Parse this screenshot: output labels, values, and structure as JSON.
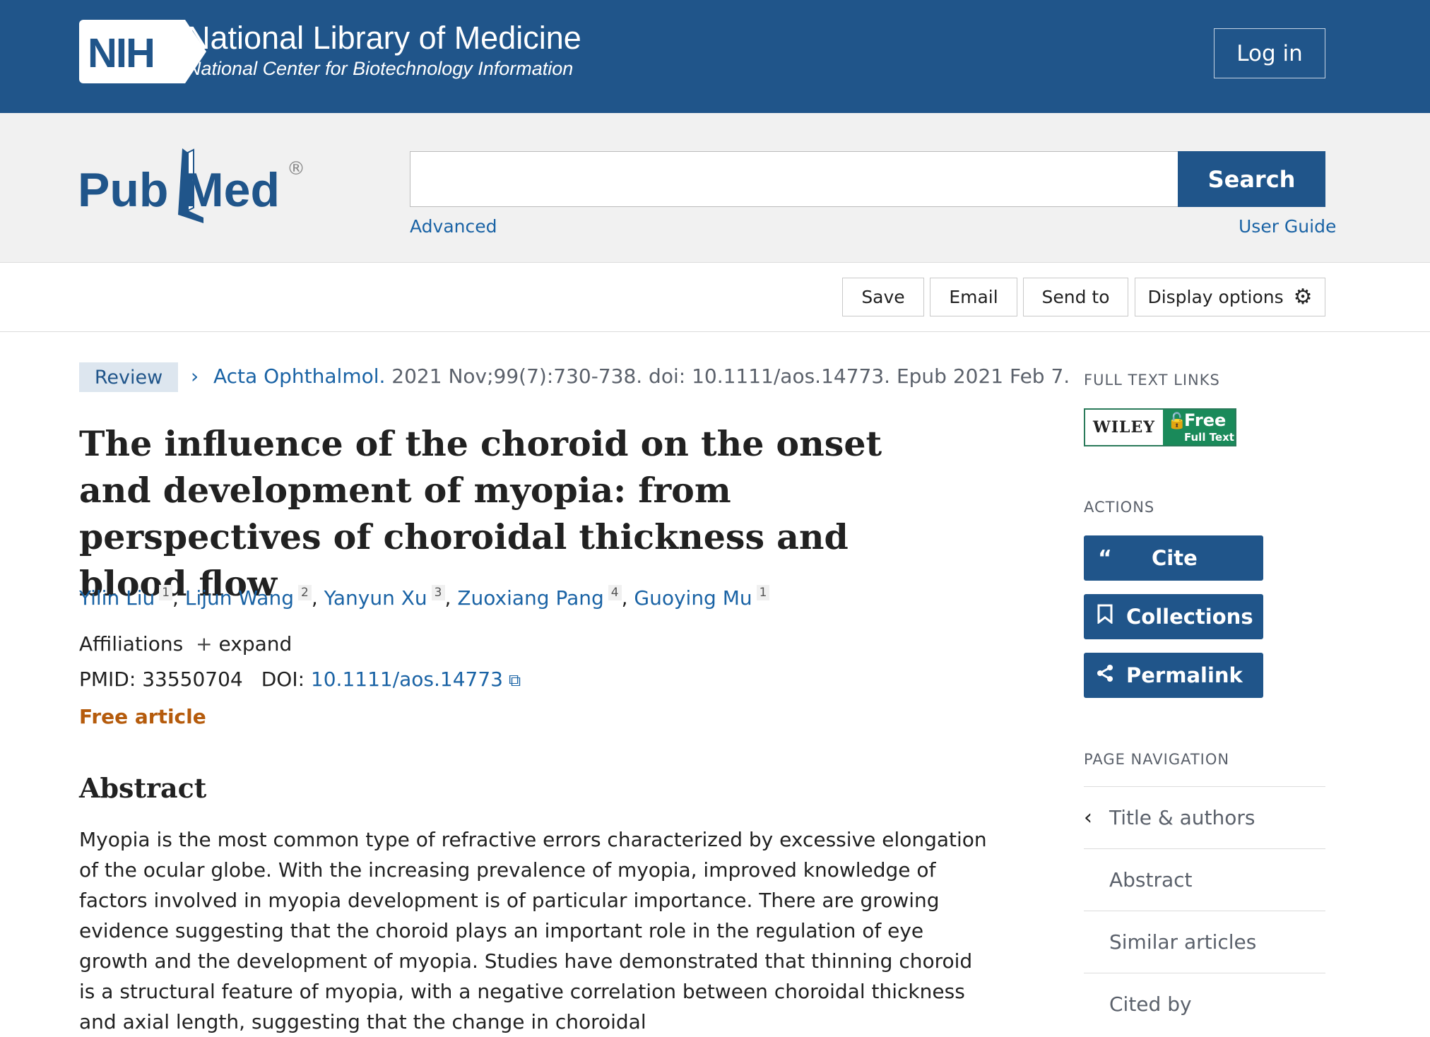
{
  "nih": {
    "badge": "NIH",
    "title": "National Library of Medicine",
    "subtitle": "National Center for Biotechnology Information",
    "login_label": "Log in"
  },
  "search": {
    "logo_pub": "Pub",
    "logo_med": "Med",
    "logo_reg": "®",
    "value": "",
    "placeholder": "",
    "button_label": "Search",
    "advanced_label": "Advanced",
    "guide_label": "User Guide"
  },
  "toolbar": {
    "save_label": "Save",
    "email_label": "Email",
    "send_label": "Send to",
    "display_label": "Display options"
  },
  "article": {
    "type": "Review",
    "journal": "Acta Ophthalmol.",
    "citation_rest": " 2021 Nov;99(7):730-738. doi: 10.1111/aos.14773. Epub 2021 Feb 7.",
    "title": "The influence of the choroid on the onset and development of myopia: from perspectives of choroidal thickness and blood flow",
    "authors": [
      {
        "name": "Yilin Liu",
        "aff": "1"
      },
      {
        "name": "Lijun Wang",
        "aff": "2"
      },
      {
        "name": "Yanyun Xu",
        "aff": "3"
      },
      {
        "name": "Zuoxiang Pang",
        "aff": "4"
      },
      {
        "name": "Guoying Mu",
        "aff": "1"
      }
    ],
    "affiliations_label": "Affiliations",
    "expand_label": "expand",
    "pmid_label": "PMID: 33550704",
    "doi_label": "DOI:",
    "doi_value": "10.1111/aos.14773",
    "free_label": "Free article",
    "abstract_heading": "Abstract",
    "abstract_text": "Myopia is the most common type of refractive errors characterized by excessive elongation of the ocular globe. With the increasing prevalence of myopia, improved knowledge of factors involved in myopia development is of particular importance. There are growing evidence suggesting that the choroid plays an important role in the regulation of eye growth and the development of myopia. Studies have demonstrated that thinning choroid is a structural feature of myopia, with a negative correlation between choroidal thickness and axial length, suggesting that the change in choroidal"
  },
  "sidebar": {
    "full_text_label": "FULL TEXT LINKS",
    "wiley_name": "WILEY",
    "wiley_free": "Free",
    "wiley_fulltext": "Full Text",
    "actions_label": "ACTIONS",
    "cite_label": "Cite",
    "collections_label": "Collections",
    "permalink_label": "Permalink",
    "page_nav_label": "PAGE NAVIGATION",
    "nav_items": [
      "Title & authors",
      "Abstract",
      "Similar articles",
      "Cited by"
    ]
  },
  "colors": {
    "brand_blue": "#20558a",
    "link_blue": "#1a63a5",
    "free_orange": "#b55b0c",
    "wiley_green": "#1a8a5a"
  }
}
